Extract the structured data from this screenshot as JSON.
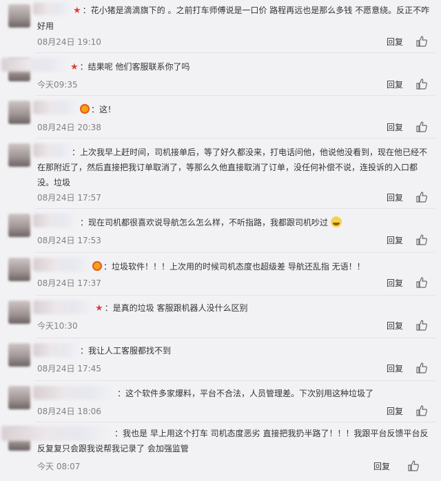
{
  "comments": [
    {
      "text": "：花小猪是滴滴旗下的 。之前打车师傅说是一口价 路程再远也是那么多钱 不愿意绕。反正不咋好用",
      "date": "08月24日 19:10",
      "reply": "回复"
    },
    {
      "text": "：结果呢 他们客服联系你了吗",
      "date": "今天09:35",
      "reply": "回复"
    },
    {
      "text": "：这！",
      "date": "08月24日 20:38",
      "reply": "回复"
    },
    {
      "text": "：上次我早上赶时间，司机接单后，等了好久都没来，打电话问他，他说他没看到，现在他已经不在那附近了，然后直接把我订单取消了，等那么久他直接取消了订单，没任何补偿不说，连投诉的入口都没。垃圾",
      "date": "08月24日 17:57",
      "reply": "回复"
    },
    {
      "text": "：现在司机都很喜欢说导航怎么怎么样，不听指路，我都跟司机吵过",
      "date": "08月24日 17:53",
      "reply": "回复"
    },
    {
      "text": "：垃圾软件！！！上次用的时候司机态度也超级差 导航还乱指 无语！！",
      "date": "08月24日 17:37",
      "reply": "回复"
    },
    {
      "text": "：是真的垃圾 客服跟机器人没什么区别",
      "date": "今天10:30",
      "reply": "回复"
    },
    {
      "text": "：我让人工客服都找不到",
      "date": "08月24日 17:45",
      "reply": "回复"
    },
    {
      "text": "：这个软件多家爆料，平台不合法，人员管理差。下次别用这种垃圾了",
      "date": "08月24日 18:06",
      "reply": "回复"
    },
    {
      "text": "：我也是 早上用这个打车 司机态度恶劣 直接把我扔半路了！！！我跟平台反馈平台反反复复只会跟我说帮我记录了 会加强监管",
      "date": "今天 08:07",
      "reply": "回复"
    }
  ],
  "icons": {
    "like": "thumbs-up-icon",
    "vip_star": "star-badge-icon",
    "medal": "medal-badge-icon",
    "grin": "grin-emoji-icon"
  },
  "colors": {
    "background": "#f2f2f5",
    "text": "#333333",
    "date": "#808080",
    "star": "#e23a3a"
  }
}
